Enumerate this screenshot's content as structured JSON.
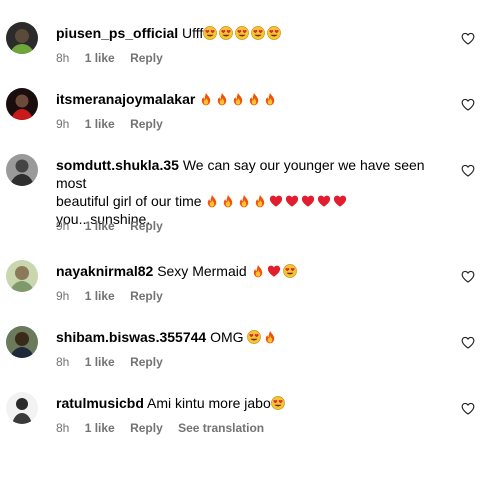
{
  "comments": [
    {
      "username": "piusen_ps_official",
      "text": "Ufff",
      "emojis": [
        "heart-eyes",
        "heart-eyes",
        "heart-eyes",
        "heart-eyes",
        "heart-eyes"
      ],
      "time": "8h",
      "likes": "1 like",
      "reply": "Reply"
    },
    {
      "username": "itsmeranajoymalakar",
      "text": "",
      "emojis": [
        "fire",
        "fire",
        "fire",
        "fire",
        "fire"
      ],
      "time": "9h",
      "likes": "1 like",
      "reply": "Reply"
    },
    {
      "username": "somdutt.shukla.35",
      "text_line1": "We can say our younger we have seen most",
      "text_line2": "beautiful girl of our time",
      "emojis": [
        "fire",
        "fire",
        "fire",
        "fire",
        "red-heart",
        "red-heart",
        "red-heart",
        "red-heart",
        "red-heart"
      ],
      "text_line3": "you...sunshine.",
      "time": "9h",
      "likes": "1 like",
      "reply": "Reply"
    },
    {
      "username": "nayaknirmal82",
      "text": "Sexy Mermaid",
      "emojis": [
        "fire",
        "red-heart",
        "heart-eyes"
      ],
      "time": "9h",
      "likes": "1 like",
      "reply": "Reply"
    },
    {
      "username": "shibam.biswas.355744",
      "text": "OMG",
      "emojis": [
        "heart-eyes",
        "fire"
      ],
      "time": "8h",
      "likes": "1 like",
      "reply": "Reply"
    },
    {
      "username": "ratulmusicbd",
      "text": "Ami kintu more jabo",
      "emojis": [
        "heart-eyes"
      ],
      "time": "8h",
      "likes": "1 like",
      "reply": "Reply",
      "see_translation": "See translation"
    }
  ],
  "icons": {
    "like": "heart-outline-icon"
  }
}
